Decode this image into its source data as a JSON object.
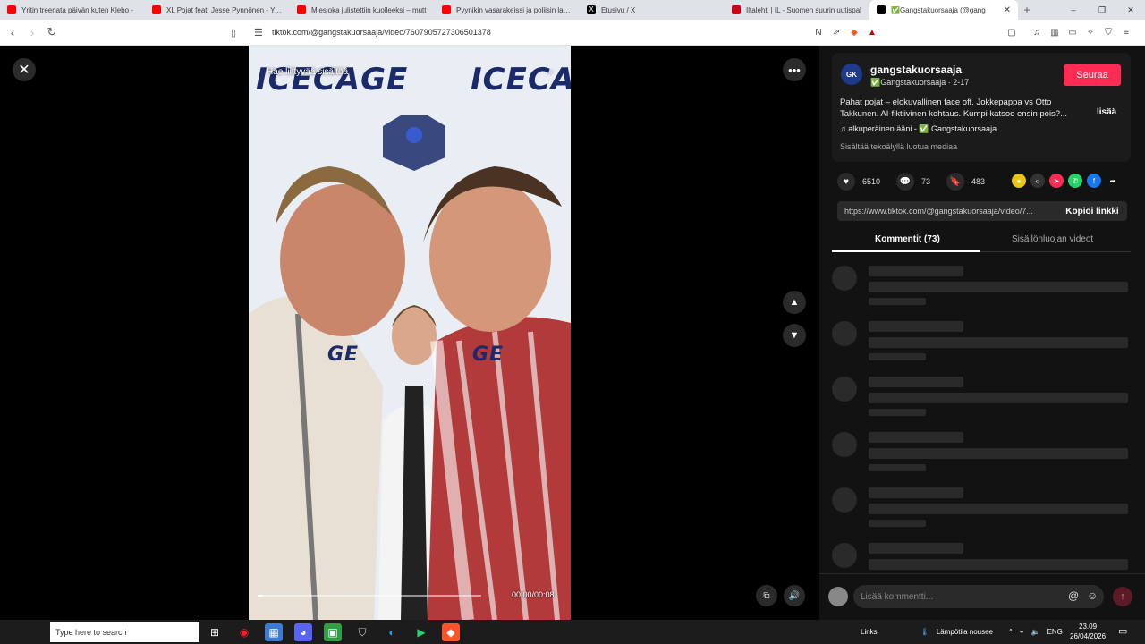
{
  "browser": {
    "tabs": [
      {
        "title": "Yritin treenata päivän kuten Klebo -",
        "color": "#ff0000"
      },
      {
        "title": "XL Pojat feat. Jesse Pynnönen - YouT",
        "color": "#ff0000"
      },
      {
        "title": "Miesjoka julistettiin kuolleeksi – mutt",
        "color": "#ff0000"
      },
      {
        "title": "Pyynikin vasarakeissi ja poliisin laukai",
        "color": "#ff0000"
      },
      {
        "title": "Etusivu / X",
        "color": "#000000"
      },
      {
        "title": "Iltalehti | IL - Suomen suurin uutispal",
        "color": "#d0021b"
      },
      {
        "title": "✅Gangstakuorsaaja (@gang",
        "color": "#000000",
        "active": true
      }
    ],
    "url": "tiktok.com/@gangstakuorsaaja/video/7607905727306501378",
    "window_controls": [
      "–",
      "❐",
      "✕"
    ]
  },
  "video": {
    "search_placeholder": "Hae liittyvää sisältöä",
    "brand": "ICECAGE",
    "brand_short": "GE",
    "time": "00:00/00:08",
    "progress": 0.02
  },
  "post": {
    "username": "gangstakuorsaaja",
    "display": "✅Gangstakuorsaaja · 2-17",
    "avatar_text": "GK",
    "follow_label": "Seuraa",
    "description": "Pahat pojat – elokuvallinen face off. Jokkepappa vs Otto Takkunen. AI-fiktiivinen kohtaus. Kumpi katsoo ensin pois?...",
    "more_label": "lisää",
    "music": "alkuperäinen ääni - ✅ Gangstakuorsaaja",
    "ai_label": "Sisältää tekoälyllä luotua mediaa",
    "likes": "6510",
    "comments": "73",
    "saves": "483",
    "link": "https://www.tiktok.com/@gangstakuorsaaja/video/7...",
    "copy_label": "Kopioi linkki",
    "tab_comments": "Kommentit (73)",
    "tab_creator": "Sisällönluojan videot",
    "comment_placeholder": "Lisää kommentti..."
  },
  "taskbar": {
    "search": "Type here to search",
    "links": "Links",
    "weather": "Lämpötila nousee",
    "lang": "ENG",
    "time": "23.09",
    "date": "26/04/2026"
  },
  "colors": {
    "accent": "#fe2c55",
    "panel": "#121212"
  }
}
